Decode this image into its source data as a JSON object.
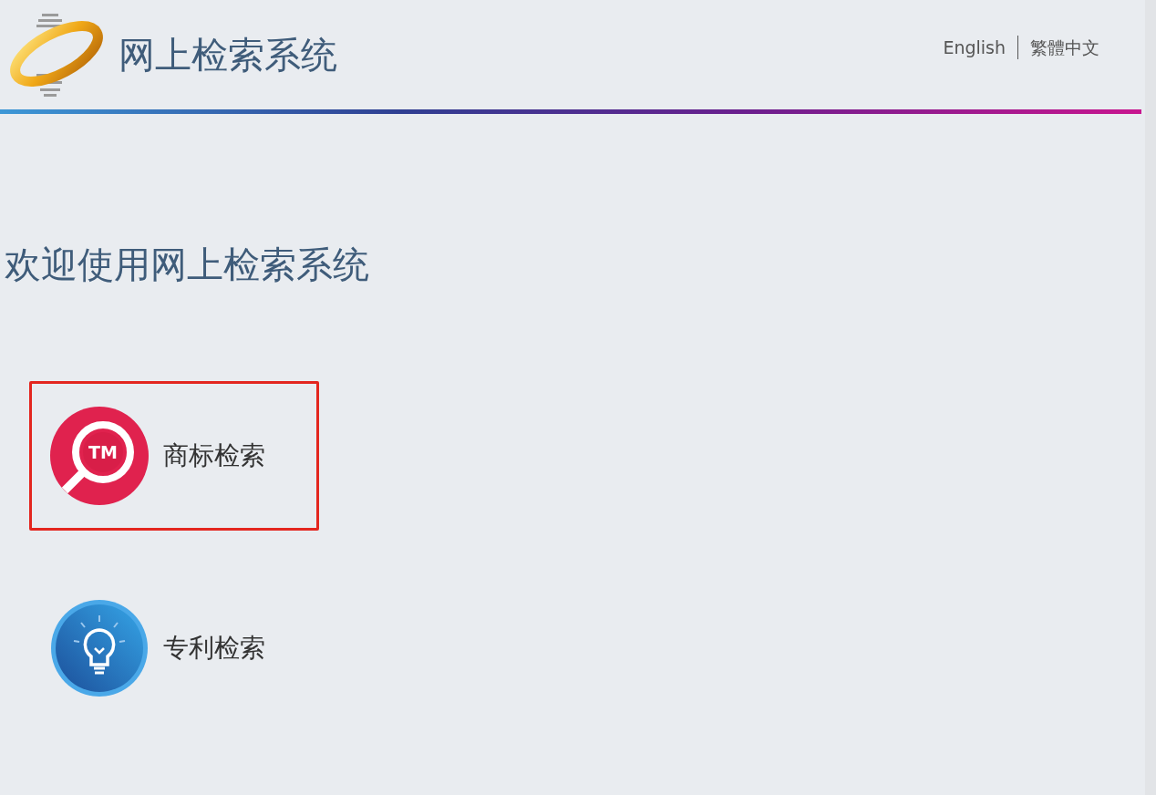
{
  "header": {
    "title": "网上检索系统",
    "languages": [
      {
        "label": "English"
      },
      {
        "label": "繁體中文"
      }
    ]
  },
  "welcome": "欢迎使用网上检索系统",
  "services": [
    {
      "kind": "trademark",
      "label": "商标检索",
      "badge_text": "TM",
      "selected": true
    },
    {
      "kind": "patent",
      "label": "专利检索",
      "selected": false
    }
  ]
}
